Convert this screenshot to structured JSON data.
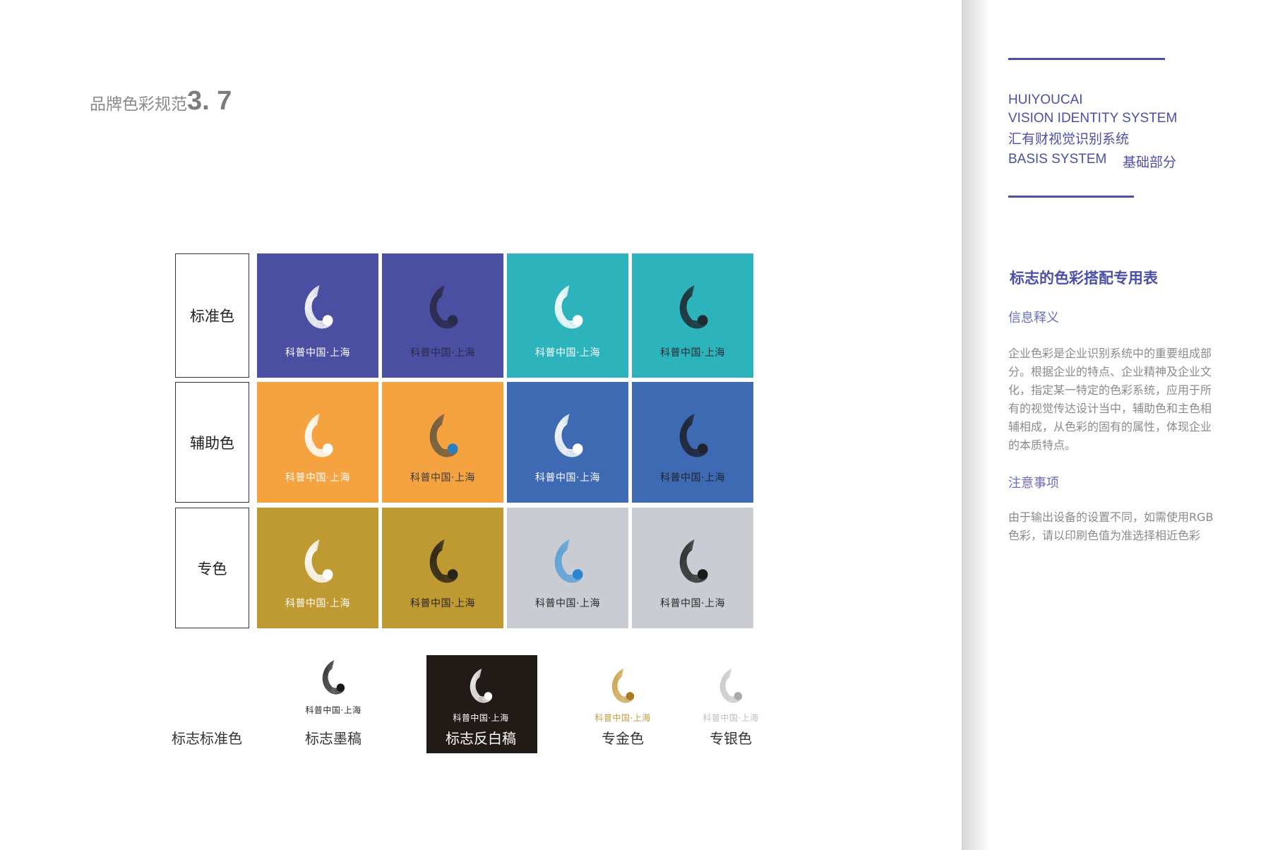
{
  "header": {
    "title_cn": "品牌色彩规范",
    "section_number": "3. 7"
  },
  "sidebar": {
    "line1": "HUIYOUCAI",
    "line2": "VISION IDENTITY SYSTEM",
    "line3": "汇有财视觉识别系统",
    "line4_en": "BASIS SYSTEM",
    "line4_cn": "基础部分",
    "section_title": "标志的色彩搭配专用表",
    "info_heading": "信息释义",
    "info_body": "企业色彩是企业识别系统中的重要组成部分。根据企业的特点、企业精神及企业文化，指定某一特定的色彩系统，应用于所有的视觉传达设计当中，辅助色和主色相辅相成，从色彩的固有的属性，体现企业的本质特点。",
    "notes_heading": "注意事项",
    "notes_body": "由于输出设备的设置不同，如需使用RGB 色彩，请以印刷色值为准选择相近色彩"
  },
  "grid": {
    "rows": [
      {
        "label": "标准色",
        "tiles": [
          {
            "bg": "#4b4fa2",
            "logo": "#ffffff",
            "accent": "#ffffff",
            "text": "#ffffff",
            "caption": "科普中国·上海"
          },
          {
            "bg": "#4b4fa2",
            "logo": "#2a2a4a",
            "accent": "#2a2a4a",
            "text": "#2a2a4a",
            "caption": "科普中国·上海"
          },
          {
            "bg": "#2db3bc",
            "logo": "#ffffff",
            "accent": "#ffffff",
            "text": "#ffffff",
            "caption": "科普中国·上海"
          },
          {
            "bg": "#2db3bc",
            "logo": "#1f2b33",
            "accent": "#1f2b33",
            "text": "#1f2b33",
            "caption": "科普中国·上海"
          }
        ]
      },
      {
        "label": "辅助色",
        "tiles": [
          {
            "bg": "#f5a340",
            "logo": "#ffffff",
            "accent": "#ffffff",
            "text": "#ffffff",
            "caption": "科普中国·上海"
          },
          {
            "bg": "#f5a340",
            "logo": "#6b5a3e",
            "accent": "#2a7fc0",
            "text": "#3a3a3a",
            "caption": "科普中国·上海"
          },
          {
            "bg": "#3d6ab3",
            "logo": "#ffffff",
            "accent": "#ffffff",
            "text": "#ffffff",
            "caption": "科普中国·上海"
          },
          {
            "bg": "#3d6ab3",
            "logo": "#1e2330",
            "accent": "#1e2330",
            "text": "#1e2330",
            "caption": "科普中国·上海"
          }
        ]
      },
      {
        "label": "专色",
        "tiles": [
          {
            "bg": "#bf9a32",
            "logo": "#ffffff",
            "accent": "#ffffff",
            "text": "#ffffff",
            "caption": "科普中国·上海"
          },
          {
            "bg": "#bf9a32",
            "logo": "#2a2418",
            "accent": "#2a2418",
            "text": "#2a2418",
            "caption": "科普中国·上海"
          },
          {
            "bg": "#c9ccd2",
            "logo": "#5aa0d6",
            "accent": "#2a86cc",
            "text": "#2a2a2a",
            "caption": "科普中国·上海"
          },
          {
            "bg": "#c9ccd2",
            "logo": "#2a2a2a",
            "accent": "#1a1a1a",
            "text": "#2a2a2a",
            "caption": "科普中国·上海"
          }
        ]
      }
    ]
  },
  "bottom": [
    {
      "label": "标志标准色",
      "has_logo": false
    },
    {
      "label": "标志墨稿",
      "caption": "科普中国·上海",
      "logo": "#2a2a2a",
      "accent": "#1a1a1a",
      "text": "#2a2a2a",
      "dark": false
    },
    {
      "label": "标志反白稿",
      "caption": "科普中国·上海",
      "logo": "#ffffff",
      "accent": "#ffffff",
      "text": "#ffffff",
      "dark": true,
      "bg": "#221a16"
    },
    {
      "label": "专金色",
      "caption": "科普中国·上海",
      "logo": "#c9a04a",
      "accent": "#a67a22",
      "text": "#c49a3e",
      "dark": false
    },
    {
      "label": "专银色",
      "caption": "科普中国·上海",
      "logo": "#c8c8cc",
      "accent": "#a9a9ad",
      "text": "#bdbdc2",
      "dark": false
    }
  ],
  "colors": {
    "accent": "#4c4fa6"
  }
}
